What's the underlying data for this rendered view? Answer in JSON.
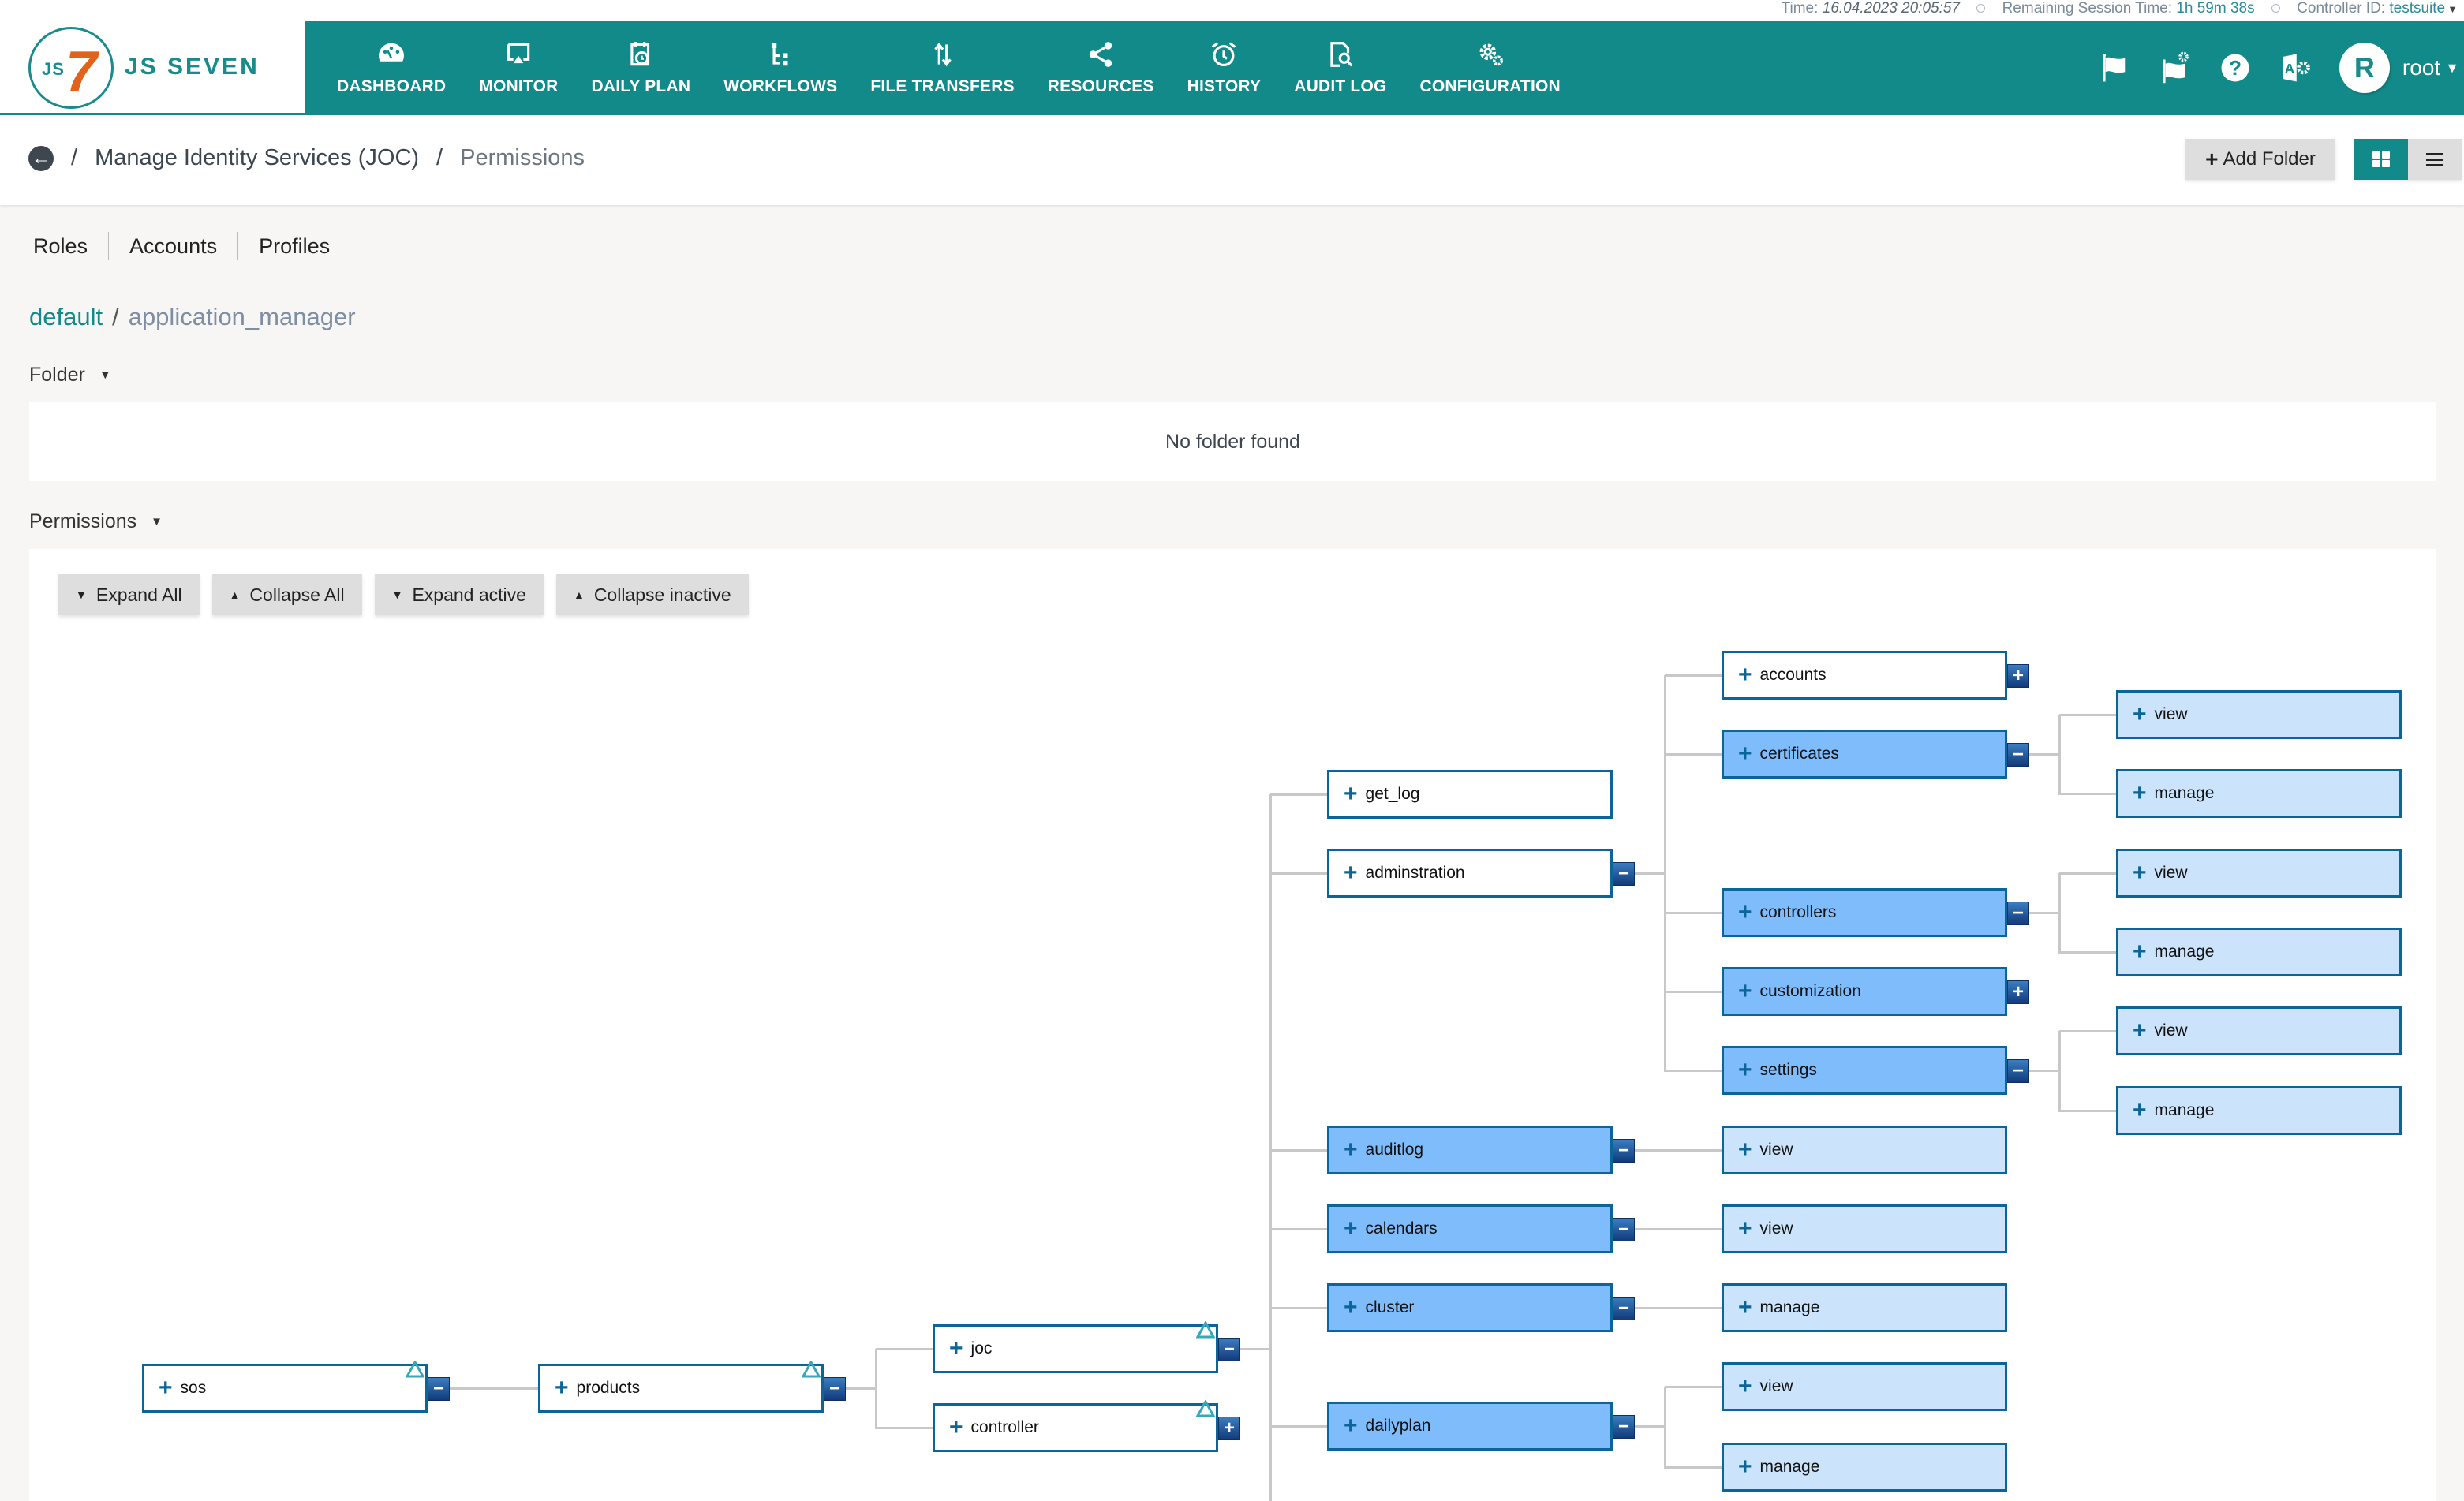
{
  "status_bar": {
    "time_label": "Time:",
    "time_value": "16.04.2023 20:05:57",
    "session_label": "Remaining Session Time:",
    "session_value": "1h 59m 38s",
    "controller_label": "Controller ID:",
    "controller_value": "testsuite"
  },
  "brand": {
    "logo_mark": "JS",
    "logo_seven": "7",
    "name": "JS SEVEN"
  },
  "nav": [
    {
      "label": "DASHBOARD",
      "icon": "dashboard-icon"
    },
    {
      "label": "MONITOR",
      "icon": "monitor-icon"
    },
    {
      "label": "DAILY PLAN",
      "icon": "calendar-clock-icon"
    },
    {
      "label": "WORKFLOWS",
      "icon": "workflow-icon"
    },
    {
      "label": "FILE TRANSFERS",
      "icon": "transfer-arrows-icon"
    },
    {
      "label": "RESOURCES",
      "icon": "share-icon"
    },
    {
      "label": "HISTORY",
      "icon": "alarm-clock-icon"
    },
    {
      "label": "AUDIT LOG",
      "icon": "file-search-icon"
    },
    {
      "label": "CONFIGURATION",
      "icon": "gears-icon"
    }
  ],
  "header_right": {
    "icons": [
      "flag-icon",
      "flag-settings-icon",
      "help-icon",
      "access-settings-icon"
    ],
    "avatar_initial": "R",
    "username": "root"
  },
  "breadcrumb": {
    "items": [
      "Manage Identity Services  (JOC)",
      "Permissions"
    ],
    "separator": "/"
  },
  "toolbar": {
    "add_folder_label": "Add Folder",
    "view_modes": [
      "grid",
      "list"
    ],
    "active_view": "grid"
  },
  "tabs": [
    "Roles",
    "Accounts",
    "Profiles"
  ],
  "path": {
    "root": "default",
    "separator": "/",
    "leaf": "application_manager"
  },
  "folder_section": {
    "label": "Folder",
    "empty_text": "No folder found"
  },
  "permissions_section": {
    "label": "Permissions",
    "buttons": [
      {
        "label": "Expand All",
        "arrow": "down"
      },
      {
        "label": "Collapse All",
        "arrow": "up"
      },
      {
        "label": "Expand active",
        "arrow": "down"
      },
      {
        "label": "Collapse inactive",
        "arrow": "up"
      }
    ]
  },
  "colors": {
    "brand_teal": "#118a89",
    "node_border": "#0b6598",
    "node_active": "#7fbcfc",
    "node_inherited": "#cce4fb",
    "logo_orange": "#e2621b"
  },
  "tree": [
    {
      "id": "sos",
      "label": "sos",
      "state": "none",
      "toggle": "minus",
      "tri": true
    },
    {
      "id": "products",
      "label": "products",
      "parent": "sos",
      "state": "none",
      "toggle": "minus",
      "tri": true
    },
    {
      "id": "joc",
      "label": "joc",
      "parent": "products",
      "state": "none",
      "toggle": "minus",
      "tri": true
    },
    {
      "id": "controller",
      "label": "controller",
      "parent": "products",
      "state": "none",
      "toggle": "plus",
      "tri": true
    },
    {
      "id": "get_log",
      "label": "get_log",
      "parent": "joc",
      "state": "none"
    },
    {
      "id": "adminstration",
      "label": "adminstration",
      "parent": "joc",
      "state": "none",
      "toggle": "minus"
    },
    {
      "id": "accounts",
      "label": "accounts",
      "parent": "adminstration",
      "state": "none",
      "toggle": "plus"
    },
    {
      "id": "certificates",
      "label": "certificates",
      "parent": "adminstration",
      "state": "active",
      "toggle": "minus"
    },
    {
      "id": "cert_view",
      "label": "view",
      "parent": "certificates",
      "state": "inherited"
    },
    {
      "id": "cert_manage",
      "label": "manage",
      "parent": "certificates",
      "state": "inherited"
    },
    {
      "id": "controllers",
      "label": "controllers",
      "parent": "adminstration",
      "state": "active",
      "toggle": "minus"
    },
    {
      "id": "ctrl_view",
      "label": "view",
      "parent": "controllers",
      "state": "inherited"
    },
    {
      "id": "ctrl_manage",
      "label": "manage",
      "parent": "controllers",
      "state": "inherited"
    },
    {
      "id": "customization",
      "label": "customization",
      "parent": "adminstration",
      "state": "active",
      "toggle": "plus"
    },
    {
      "id": "settings",
      "label": "settings",
      "parent": "adminstration",
      "state": "active",
      "toggle": "minus"
    },
    {
      "id": "set_view",
      "label": "view",
      "parent": "settings",
      "state": "inherited"
    },
    {
      "id": "set_manage",
      "label": "manage",
      "parent": "settings",
      "state": "inherited"
    },
    {
      "id": "auditlog",
      "label": "auditlog",
      "parent": "joc",
      "state": "active",
      "toggle": "minus"
    },
    {
      "id": "al_view",
      "label": "view",
      "parent": "auditlog",
      "state": "inherited"
    },
    {
      "id": "calendars",
      "label": "calendars",
      "parent": "joc",
      "state": "active",
      "toggle": "minus"
    },
    {
      "id": "cal_view",
      "label": "view",
      "parent": "calendars",
      "state": "inherited"
    },
    {
      "id": "cluster",
      "label": "cluster",
      "parent": "joc",
      "state": "active",
      "toggle": "minus"
    },
    {
      "id": "cl_manage",
      "label": "manage",
      "parent": "cluster",
      "state": "inherited"
    },
    {
      "id": "dailyplan",
      "label": "dailyplan",
      "parent": "joc",
      "state": "active",
      "toggle": "minus"
    },
    {
      "id": "dp_view",
      "label": "view",
      "parent": "dailyplan",
      "state": "inherited"
    },
    {
      "id": "dp_manage",
      "label": "manage",
      "parent": "dailyplan",
      "state": "inherited"
    }
  ]
}
